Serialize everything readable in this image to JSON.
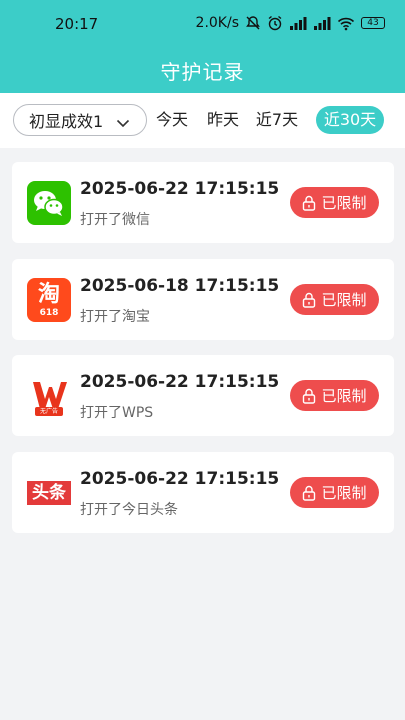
{
  "status_bar": {
    "time": "20:17",
    "net_speed": "2.0K/s",
    "battery": "43",
    "icons": [
      "mute-icon",
      "alarm-icon",
      "signal-hd-icon",
      "signal-hd-icon",
      "wifi-icon",
      "battery-icon"
    ]
  },
  "header": {
    "title": "守护记录"
  },
  "filter": {
    "dropdown_value": "初显成效1",
    "tabs": [
      "今天",
      "昨天",
      "近7天",
      "近30天"
    ],
    "active_tab": "近30天"
  },
  "records": [
    {
      "app": "wechat",
      "time": "2025-06-22 17:15:15",
      "desc": "打开了微信",
      "status": "已限制"
    },
    {
      "app": "taobao",
      "time": "2025-06-18 17:15:15",
      "desc": "打开了淘宝",
      "status": "已限制",
      "icon_text": "淘",
      "icon_sub": "618"
    },
    {
      "app": "wps",
      "time": "2025-06-22 17:15:15",
      "desc": "打开了WPS",
      "status": "已限制",
      "icon_sub": "无广告"
    },
    {
      "app": "toutiao",
      "time": "2025-06-22 17:15:15",
      "desc": "打开了今日头条",
      "status": "已限制",
      "icon_text": "头条"
    }
  ],
  "colors": {
    "accent": "#3ccdc8",
    "danger": "#ee4d4d",
    "background": "#f2f3f5"
  }
}
